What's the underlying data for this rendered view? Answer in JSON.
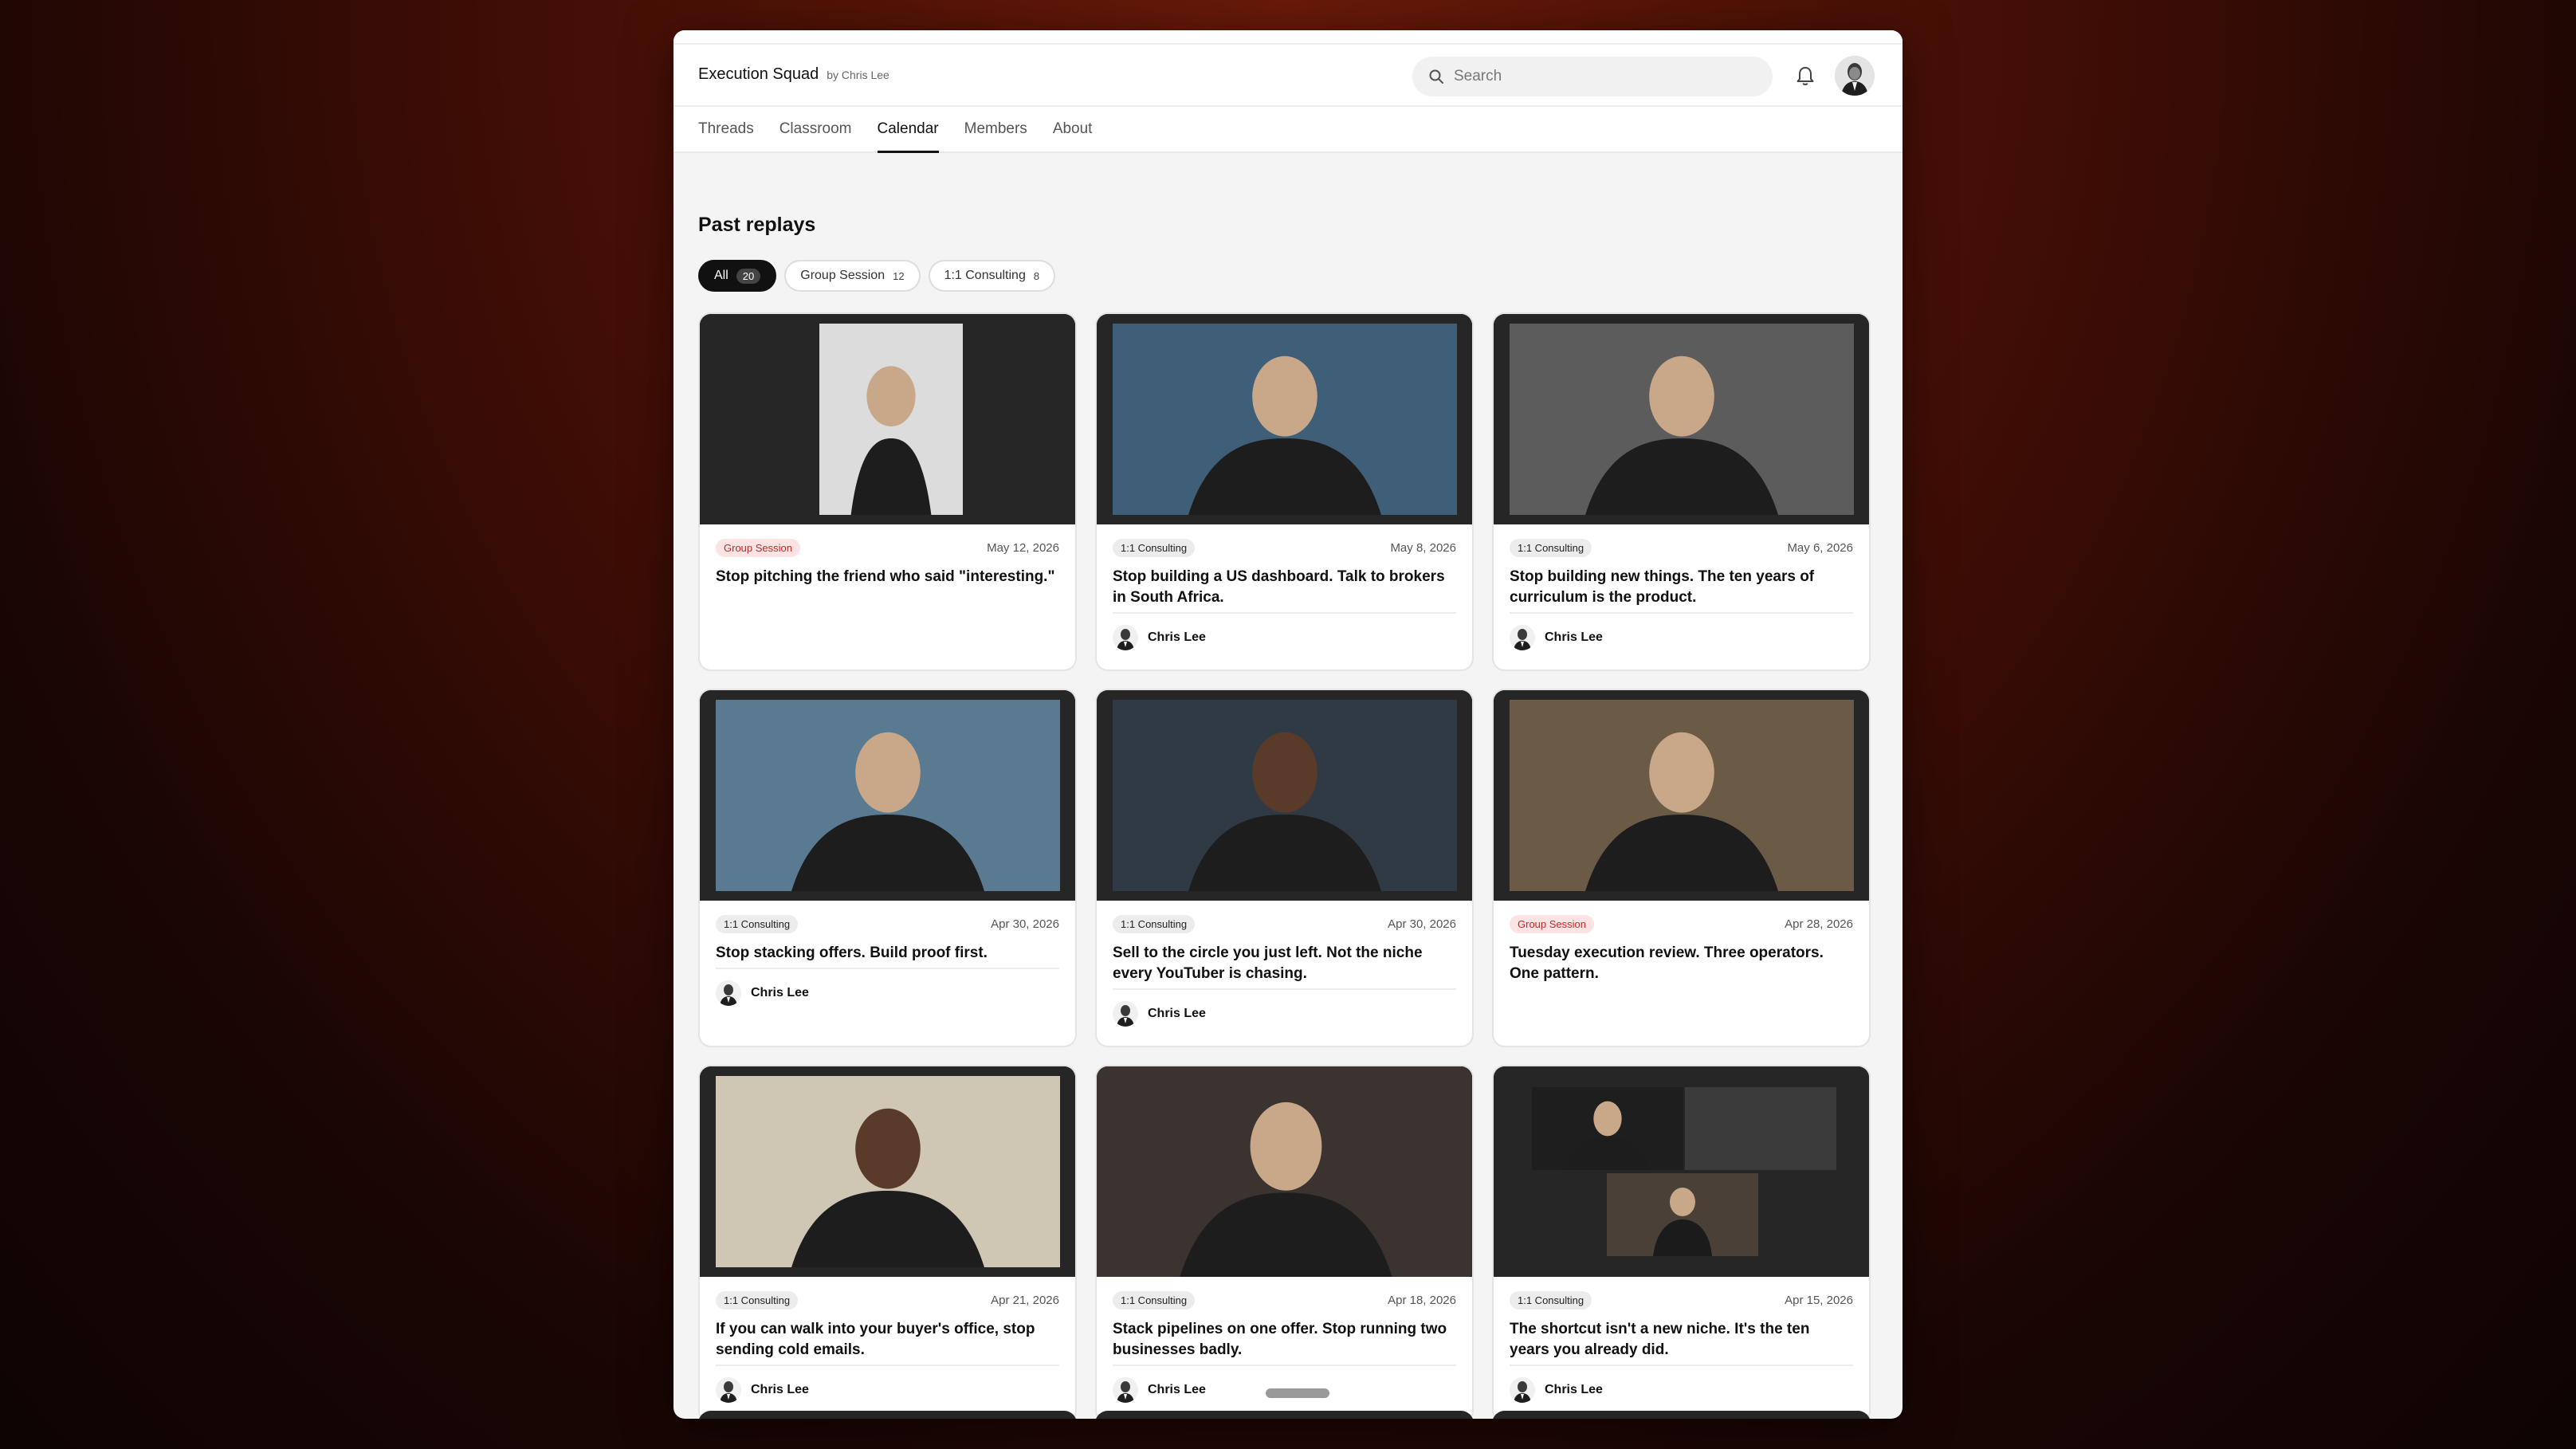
{
  "header": {
    "community_name": "Execution Squad",
    "byline": "by Chris Lee",
    "search_placeholder": "Search",
    "icons": {
      "search": "search-icon",
      "bell": "bell-icon",
      "avatar": "user-avatar"
    }
  },
  "nav": {
    "tabs": [
      {
        "label": "Threads",
        "active": false
      },
      {
        "label": "Classroom",
        "active": false
      },
      {
        "label": "Calendar",
        "active": true
      },
      {
        "label": "Members",
        "active": false
      },
      {
        "label": "About",
        "active": false
      }
    ]
  },
  "replays": {
    "title": "Past replays",
    "filters": [
      {
        "label": "All",
        "count": "20",
        "active": true
      },
      {
        "label": "Group Session",
        "count": "12",
        "active": false
      },
      {
        "label": "1:1 Consulting",
        "count": "8",
        "active": false
      }
    ],
    "cards": [
      {
        "tag": "Group Session",
        "date": "May 12, 2026",
        "title": "Stop pitching the friend who said \"interesting.\"",
        "author": ""
      },
      {
        "tag": "1:1 Consulting",
        "date": "May 8, 2026",
        "title": "Stop building a US dashboard. Talk to brokers in South Africa.",
        "author": "Chris Lee"
      },
      {
        "tag": "1:1 Consulting",
        "date": "May 6, 2026",
        "title": "Stop building new things. The ten years of curriculum is the product.",
        "author": "Chris Lee"
      },
      {
        "tag": "1:1 Consulting",
        "date": "Apr 30, 2026",
        "title": "Stop stacking offers. Build proof first.",
        "author": "Chris Lee"
      },
      {
        "tag": "1:1 Consulting",
        "date": "Apr 30, 2026",
        "title": "Sell to the circle you just left. Not the niche every YouTuber is chasing.",
        "author": "Chris Lee"
      },
      {
        "tag": "Group Session",
        "date": "Apr 28, 2026",
        "title": "Tuesday execution review. Three operators. One pattern.",
        "author": ""
      },
      {
        "tag": "1:1 Consulting",
        "date": "Apr 21, 2026",
        "title": "If you can walk into your buyer's office, stop sending cold emails.",
        "author": "Chris Lee"
      },
      {
        "tag": "1:1 Consulting",
        "date": "Apr 18, 2026",
        "title": "Stack pipelines on one offer. Stop running two businesses badly.",
        "author": "Chris Lee"
      },
      {
        "tag": "1:1 Consulting",
        "date": "Apr 15, 2026",
        "title": "The shortcut isn't a new niche. It's the ten years you already did.",
        "author": "Chris Lee"
      }
    ]
  },
  "colors": {
    "group_badge_bg": "#fde3e3",
    "group_badge_text": "#c62828",
    "consulting_badge_bg": "#ececec",
    "active_chip": "#111111"
  }
}
